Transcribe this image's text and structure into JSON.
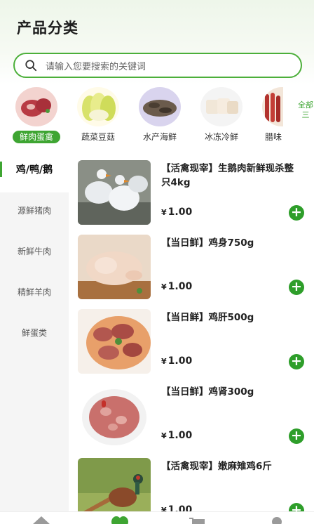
{
  "header": {
    "title": "产品分类"
  },
  "search": {
    "placeholder": "请输入您要搜索的关键词"
  },
  "categories": [
    {
      "label": "鲜肉蛋禽",
      "active": true
    },
    {
      "label": "蔬菜豆菇",
      "active": false
    },
    {
      "label": "水产海鲜",
      "active": false
    },
    {
      "label": "冰冻冷鲜",
      "active": false
    },
    {
      "label": "腊味",
      "active": false
    }
  ],
  "all_button": {
    "label": "全部三"
  },
  "sidebar": {
    "items": [
      {
        "label": "鸡/鸭/鹅",
        "active": true
      },
      {
        "label": "源鲜猪肉",
        "active": false
      },
      {
        "label": "新鲜牛肉",
        "active": false
      },
      {
        "label": "精鲜羊肉",
        "active": false
      },
      {
        "label": "鲜蛋类",
        "active": false
      }
    ]
  },
  "products": [
    {
      "name": "【活禽现宰】生鹅肉新鲜现杀整只4kg",
      "currency": "¥",
      "price": "1.00",
      "image": "geese"
    },
    {
      "name": "【当日鲜】鸡身750g",
      "currency": "¥",
      "price": "1.00",
      "image": "chicken-body"
    },
    {
      "name": "【当日鲜】鸡肝500g",
      "currency": "¥",
      "price": "1.00",
      "image": "chicken-liver"
    },
    {
      "name": "【当日鲜】鸡肾300g",
      "currency": "¥",
      "price": "1.00",
      "image": "chicken-gizzard"
    },
    {
      "name": "【活禽现宰】嫩麻雉鸡6斤",
      "currency": "¥",
      "price": "1.00",
      "image": "pheasant"
    }
  ],
  "colors": {
    "accent": "#3ea532",
    "add_button": "#2e9e2a",
    "search_border": "#4caf3a"
  },
  "tabbar": {
    "icons": [
      "home-icon",
      "category-icon",
      "cart-icon",
      "user-icon"
    ]
  }
}
